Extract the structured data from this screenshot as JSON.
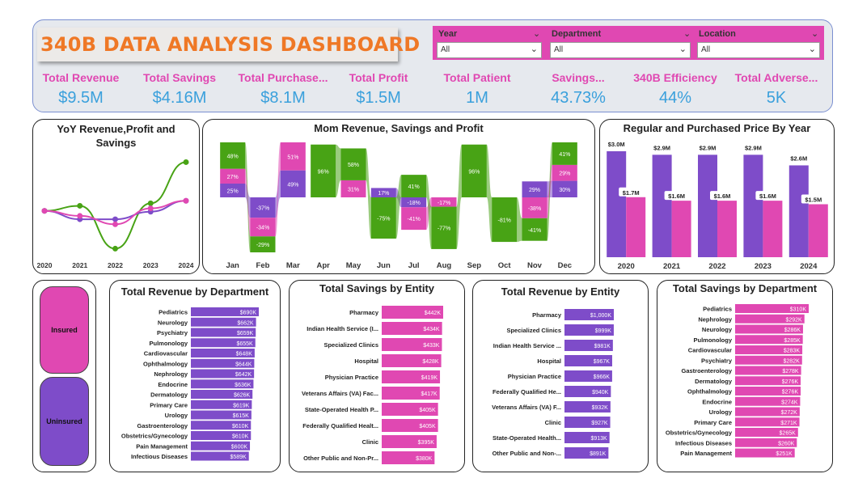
{
  "title": "340B DATA ANALYSIS DASHBOARD",
  "filters": [
    {
      "label": "Year",
      "value": "All"
    },
    {
      "label": "Department",
      "value": "All"
    },
    {
      "label": "Location",
      "value": "All"
    }
  ],
  "kpis": [
    {
      "label": "Total Revenue",
      "value": "$9.5M"
    },
    {
      "label": "Total Savings",
      "value": "$4.16M"
    },
    {
      "label": "Total Purchase...",
      "value": "$8.1M"
    },
    {
      "label": "Total Profit",
      "value": "$1.5M"
    },
    {
      "label": "Total Patient",
      "value": "1M"
    },
    {
      "label": "Savings...",
      "value": "43.73%"
    },
    {
      "label": "340B Efficiency",
      "value": "44%"
    },
    {
      "label": "Total Adverse...",
      "value": "5K"
    }
  ],
  "legend_buttons": {
    "insured": "Insured",
    "uninsured": "Uninsured"
  },
  "colors": {
    "pink": "#e048b2",
    "purple": "#7e4cc9",
    "green": "#48a315",
    "orange": "#ef7826",
    "blue": "#3aa0dc"
  },
  "chart_data": [
    {
      "type": "line",
      "title": "YoY Revenue,Profit and Savings",
      "categories": [
        "2020",
        "2021",
        "2022",
        "2023",
        "2024"
      ],
      "series": [
        {
          "values": [
            0.0,
            0.06,
            -0.45,
            0.09,
            0.58
          ],
          "color": "#48a315"
        },
        {
          "values": [
            0.0,
            -0.1,
            -0.1,
            -0.01,
            0.12
          ],
          "color": "#7e4cc9"
        },
        {
          "values": [
            0.0,
            -0.06,
            -0.16,
            0.03,
            0.12
          ],
          "color": "#e048b2"
        }
      ]
    },
    {
      "type": "bar",
      "title": "Mom Revenue, Savings and Profit",
      "categories": [
        "Jan",
        "Feb",
        "Mar",
        "Apr",
        "May",
        "Jun",
        "Jul",
        "Aug",
        "Sep",
        "Oct",
        "Nov",
        "Dec"
      ],
      "series": [
        {
          "color": "#7e4cc9",
          "values": [
            25,
            -37,
            49,
            null,
            null,
            17,
            -18,
            null,
            null,
            null,
            29,
            30
          ],
          "labels": [
            "25%",
            "-37%",
            "49%",
            "",
            "",
            "17%",
            "-18%",
            "",
            "",
            "",
            "29%",
            "30%"
          ]
        },
        {
          "color": "#e048b2",
          "values": [
            27,
            -34,
            51,
            null,
            31,
            null,
            -41,
            -17,
            null,
            null,
            -38,
            29
          ],
          "labels": [
            "27%",
            "-34%",
            "51%",
            "",
            "31%",
            "",
            "-41%",
            "-17%",
            "",
            "",
            "-38%",
            "29%"
          ]
        },
        {
          "color": "#48a315",
          "values": [
            48,
            -29,
            null,
            96,
            58,
            -75,
            41,
            -77,
            96,
            -81,
            -41,
            41
          ],
          "labels": [
            "48%",
            "-29%",
            "",
            "96%",
            "58%",
            "-75%",
            "41%",
            "-77%",
            "96%",
            "-81%",
            "-41%",
            "41%"
          ]
        }
      ]
    },
    {
      "type": "bar",
      "title": "Regular and Purchased Price By Year",
      "categories": [
        "2020",
        "2021",
        "2022",
        "2023",
        "2024"
      ],
      "series": [
        {
          "color": "#7e4cc9",
          "values": [
            3.0,
            2.9,
            2.9,
            2.9,
            2.6
          ],
          "labels": [
            "$3.0M",
            "$2.9M",
            "$2.9M",
            "$2.9M",
            "$2.6M"
          ]
        },
        {
          "color": "#e048b2",
          "values": [
            1.7,
            1.6,
            1.6,
            1.6,
            1.5
          ],
          "labels": [
            "$1.7M",
            "$1.6M",
            "$1.6M",
            "$1.6M",
            "$1.5M"
          ]
        }
      ]
    },
    {
      "type": "bar",
      "title": "Total Revenue by Department",
      "color": "#7e4cc9",
      "categories": [
        "Pediatrics",
        "Neurology",
        "Psychiatry",
        "Pulmonology",
        "Cardiovascular",
        "Ophthalmology",
        "Nephrology",
        "Endocrine",
        "Dermatology",
        "Primary Care",
        "Urology",
        "Gastroenterology",
        "Obstetrics/Gynecology",
        "Pain Management",
        "Infectious Diseases"
      ],
      "values": [
        690,
        662,
        659,
        655,
        648,
        644,
        642,
        636,
        626,
        619,
        615,
        610,
        610,
        600,
        589
      ],
      "labels": [
        "$690K",
        "$662K",
        "$659K",
        "$655K",
        "$648K",
        "$644K",
        "$642K",
        "$636K",
        "$626K",
        "$619K",
        "$615K",
        "$610K",
        "$610K",
        "$600K",
        "$589K"
      ]
    },
    {
      "type": "bar",
      "title": "Total Savings by Entity",
      "color": "#e048b2",
      "categories": [
        "Pharmacy",
        "Indian Health Service (I...",
        "Specialized Clinics",
        "Hospital",
        "Physician Practice",
        "Veterans Affairs (VA) Fac...",
        "State-Operated Health P...",
        "Federally Qualified Healt...",
        "Clinic",
        "Other Public and Non-Pr..."
      ],
      "values": [
        442,
        434,
        433,
        428,
        419,
        417,
        405,
        405,
        395,
        380
      ],
      "labels": [
        "$442K",
        "$434K",
        "$433K",
        "$428K",
        "$419K",
        "$417K",
        "$405K",
        "$405K",
        "$395K",
        "$380K"
      ]
    },
    {
      "type": "bar",
      "title": "Total Revenue by Entity",
      "color": "#7e4cc9",
      "categories": [
        "Pharmacy",
        "Specialized Clinics",
        "Indian Health Service ...",
        "Hospital",
        "Physician Practice",
        "Federally Qualified He...",
        "Veterans Affairs (VA) F...",
        "Clinic",
        "State-Operated Health...",
        "Other Public and Non-..."
      ],
      "values": [
        1000,
        999,
        981,
        967,
        966,
        940,
        932,
        927,
        913,
        891
      ],
      "labels": [
        "$1,000K",
        "$999K",
        "$981K",
        "$967K",
        "$966K",
        "$940K",
        "$932K",
        "$927K",
        "$913K",
        "$891K"
      ]
    },
    {
      "type": "bar",
      "title": "Total Savings by Department",
      "color": "#e048b2",
      "categories": [
        "Pediatrics",
        "Nephrology",
        "Neurology",
        "Pulmonology",
        "Cardiovascular",
        "Psychiatry",
        "Gastroenterology",
        "Dermatology",
        "Ophthalmology",
        "Endocrine",
        "Urology",
        "Primary Care",
        "Obstetrics/Gynecology",
        "Infectious Diseases",
        "Pain Management"
      ],
      "values": [
        310,
        292,
        286,
        285,
        283,
        282,
        278,
        276,
        276,
        274,
        272,
        271,
        265,
        260,
        251
      ],
      "labels": [
        "$310K",
        "$292K",
        "$286K",
        "$285K",
        "$283K",
        "$282K",
        "$278K",
        "$276K",
        "$276K",
        "$274K",
        "$272K",
        "$271K",
        "$265K",
        "$260K",
        "$251K"
      ]
    }
  ]
}
